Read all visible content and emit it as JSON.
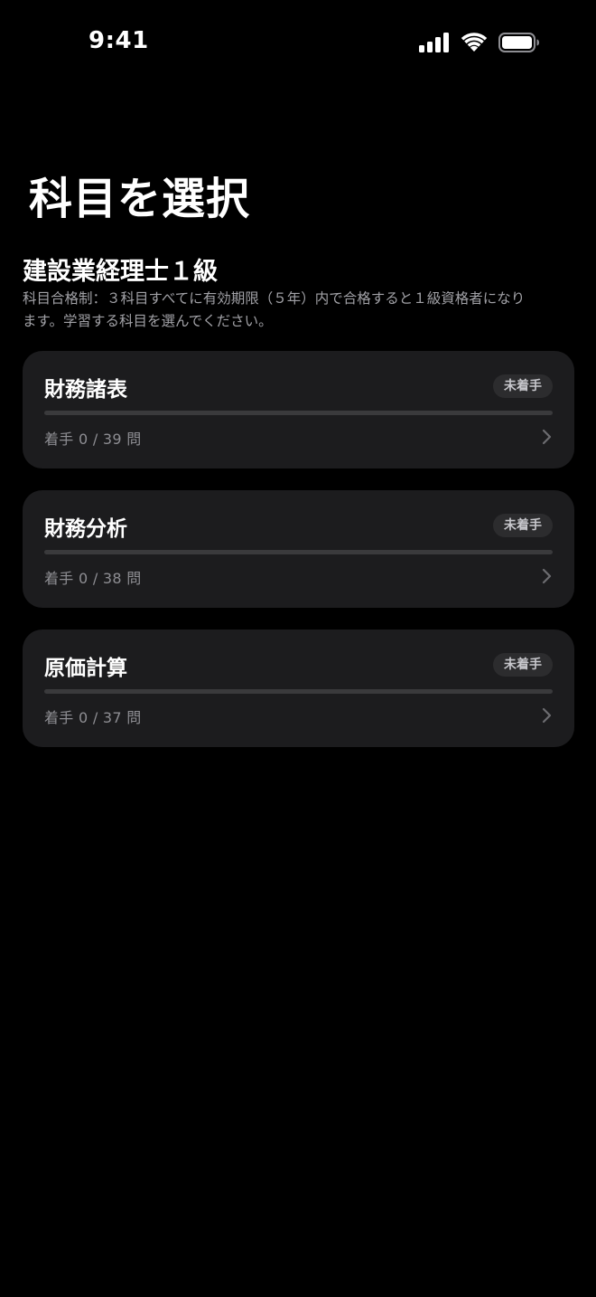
{
  "status_bar": {
    "time": "9:41",
    "icons": [
      "cellular-signal-icon",
      "wifi-icon",
      "battery-icon"
    ]
  },
  "header": {
    "title": "科目を選択"
  },
  "qualification": {
    "title": "建設業経理士１級",
    "description": "科目合格制：３科目すべてに有効期限（５年）内で合格すると１級資格者になります。学習する科目を選んでください。"
  },
  "subjects": [
    {
      "name": "財務諸表",
      "badge": "未着手",
      "progress_label": "着手 0 / 39 問",
      "answered": 0,
      "total": 39
    },
    {
      "name": "財務分析",
      "badge": "未着手",
      "progress_label": "着手 0 / 38 問",
      "answered": 0,
      "total": 38
    },
    {
      "name": "原価計算",
      "badge": "未着手",
      "progress_label": "着手 0 / 37 問",
      "answered": 0,
      "total": 37
    }
  ],
  "colors": {
    "background": "#000000",
    "card": "#1c1c1e",
    "badge_bg": "#2c2c2e",
    "secondary_text": "#8e8e93",
    "track": "#3a3a3c"
  }
}
